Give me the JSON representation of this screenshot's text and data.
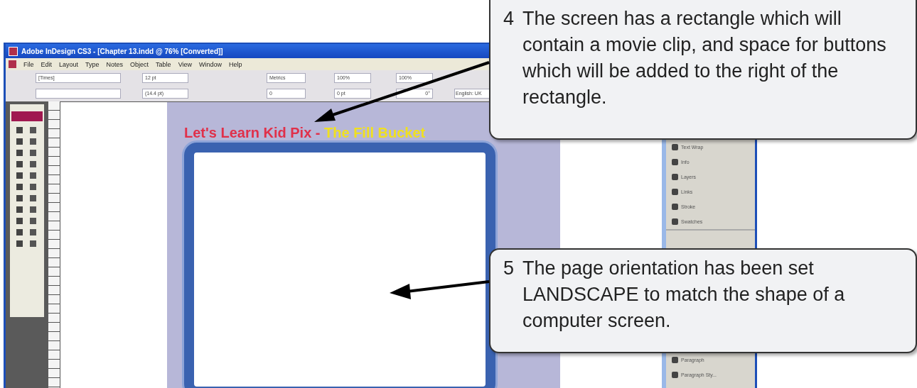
{
  "window": {
    "title": "Adobe InDesign CS3 - [Chapter 13.indd @ 76% [Converted]]"
  },
  "menu": [
    "File",
    "Edit",
    "Layout",
    "Type",
    "Notes",
    "Object",
    "Table",
    "View",
    "Window",
    "Help"
  ],
  "control_fields": {
    "font": "[Times]",
    "size": "12 pt",
    "leading": "(14.4 pt)",
    "kerning": "Metrics",
    "tracking": "0",
    "vertical_scale": "100%",
    "baseline_shift": "0 pt",
    "horizontal_scale": "100%",
    "skew": "0°",
    "language": "English: UK"
  },
  "headline": [
    {
      "text": "Let's Learn Kid Pix - ",
      "color": "#e0304a"
    },
    {
      "text": "The Fill Bucket",
      "color": "#f0e020"
    }
  ],
  "panels": [
    {
      "label": "Text Wrap"
    },
    {
      "label": "Info"
    },
    {
      "label": "Layers"
    },
    {
      "label": "Links"
    },
    {
      "label": "Stroke"
    },
    {
      "label": "Swatches"
    },
    {
      "label": "Paragraph"
    },
    {
      "label": "Paragraph Sty..."
    }
  ],
  "callouts": [
    {
      "number": "4",
      "text": "The screen has a rectangle which will contain a movie clip, and space for buttons which will be added to the right of the rectangle."
    },
    {
      "number": "5",
      "text": "The page orientation has been set LANDSCAPE to match the shape of a computer screen."
    }
  ]
}
